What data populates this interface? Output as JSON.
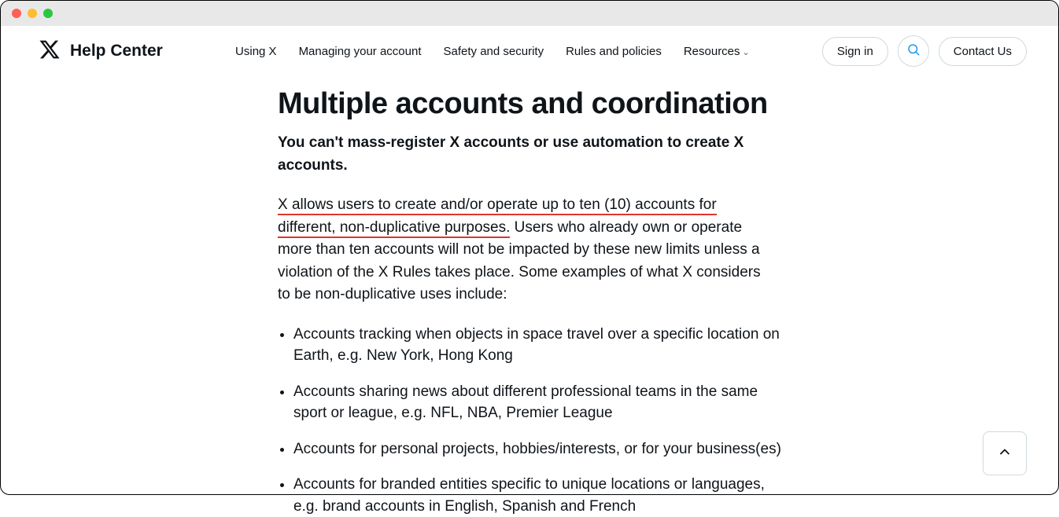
{
  "brand": {
    "title": "Help Center"
  },
  "nav": {
    "items": [
      {
        "label": "Using X"
      },
      {
        "label": "Managing your account"
      },
      {
        "label": "Safety and security"
      },
      {
        "label": "Rules and policies"
      },
      {
        "label": "Resources",
        "dropdown": true
      }
    ]
  },
  "actions": {
    "sign_in": "Sign in",
    "contact": "Contact Us"
  },
  "page": {
    "title": "Multiple accounts and coordination",
    "lead": "You can't mass-register X accounts or use automation to create X accounts.",
    "para_highlight_a": "X allows users to create and/or operate up to ten (10) accounts for",
    "para_highlight_b": "different, non-duplicative purposes.",
    "para_rest": " Users who already own or operate more than ten accounts will not be impacted by these new limits unless a violation of the X Rules takes place. Some examples of what X considers to be non-duplicative uses include:",
    "examples": [
      "Accounts tracking when objects in space travel over a specific location on Earth, e.g. New York, Hong Kong",
      "Accounts sharing news about different professional teams in the same sport or league, e.g. NFL, NBA, Premier League",
      "Accounts for personal projects, hobbies/interests, or for your business(es)",
      "Accounts for branded entities specific to unique locations or languages, e.g. brand accounts in English, Spanish and French"
    ]
  }
}
